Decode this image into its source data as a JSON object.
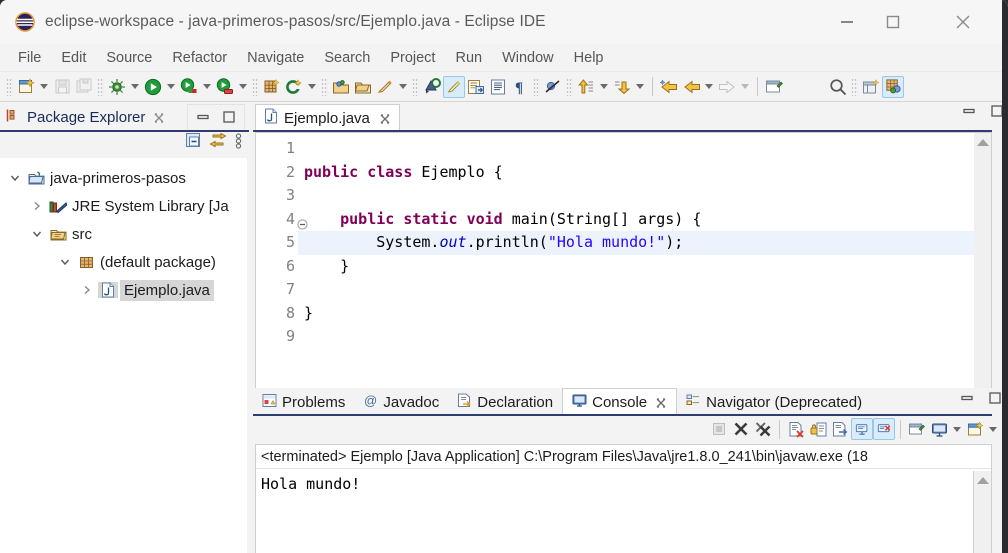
{
  "window": {
    "title": "eclipse-workspace - java-primeros-pasos/src/Ejemplo.java - Eclipse IDE",
    "logo_icon": "eclipse-logo",
    "minimize_label": "—",
    "maximize_label": "☐",
    "close_label": "✕",
    "chrome_color": "#f6f6f6",
    "accent_color": "#2e3c6e"
  },
  "menubar": {
    "items": [
      {
        "label": "File"
      },
      {
        "label": "Edit"
      },
      {
        "label": "Source"
      },
      {
        "label": "Refactor"
      },
      {
        "label": "Navigate"
      },
      {
        "label": "Search"
      },
      {
        "label": "Project"
      },
      {
        "label": "Run"
      },
      {
        "label": "Window"
      },
      {
        "label": "Help"
      }
    ]
  },
  "toolbar": {
    "groups": [
      {
        "items": [
          {
            "icon": "new-wizard-icon",
            "enabled": true,
            "dropdown": true
          },
          {
            "icon": "save-icon",
            "enabled": false
          },
          {
            "icon": "save-all-icon",
            "enabled": false
          }
        ]
      },
      {
        "items": [
          {
            "icon": "debug-icon",
            "enabled": true,
            "dropdown": true
          },
          {
            "icon": "run-icon",
            "enabled": true,
            "dropdown": true
          },
          {
            "icon": "run-external-tools-icon",
            "enabled": true,
            "dropdown": true
          },
          {
            "icon": "coverage-icon",
            "enabled": true,
            "dropdown": true
          }
        ]
      },
      {
        "items": [
          {
            "icon": "new-java-package-icon",
            "enabled": true
          },
          {
            "icon": "new-java-class-icon",
            "enabled": true,
            "dropdown": true
          }
        ]
      },
      {
        "items": [
          {
            "icon": "open-type-icon",
            "enabled": true
          },
          {
            "icon": "open-task-icon",
            "enabled": true
          },
          {
            "icon": "toggle-mark-occurrences-icon",
            "enabled": true,
            "dropdown": true
          }
        ]
      },
      {
        "items": [
          {
            "icon": "search-type-icon",
            "enabled": true
          },
          {
            "icon": "toggle-highlight-icon",
            "enabled": true,
            "selected": true
          },
          {
            "icon": "block-selection-icon",
            "enabled": true
          },
          {
            "icon": "show-whitespace-icon",
            "enabled": true
          },
          {
            "icon": "pilcrow-icon",
            "enabled": true
          }
        ]
      },
      {
        "items": [
          {
            "icon": "skip-all-breakpoints-icon",
            "enabled": true
          }
        ]
      },
      {
        "items": [
          {
            "icon": "next-annotation-icon",
            "enabled": true,
            "dropdown": true
          },
          {
            "icon": "previous-annotation-icon",
            "enabled": true,
            "dropdown": true
          }
        ]
      },
      {
        "items": [
          {
            "icon": "back-history-icon",
            "enabled": true
          },
          {
            "icon": "forward-history-icon",
            "enabled": true,
            "dropdown": true
          },
          {
            "icon": "forward-arrow-icon",
            "enabled": false,
            "dropdown": true
          }
        ]
      },
      {
        "items": [
          {
            "icon": "new-window-icon",
            "enabled": true
          }
        ]
      },
      {
        "items": [
          {
            "icon": "quick-access-search-icon",
            "enabled": true
          }
        ]
      },
      {
        "items": [
          {
            "icon": "open-perspective-icon",
            "enabled": true
          },
          {
            "icon": "java-perspective-icon",
            "enabled": true,
            "selected": true
          }
        ]
      }
    ]
  },
  "package_explorer": {
    "tab_label": "Package Explorer",
    "tab_icon": "package-explorer-icon",
    "close_icon": "close-icon",
    "view_buttons": [
      {
        "icon": "minimize-icon"
      },
      {
        "icon": "maximize-icon"
      }
    ],
    "toolbar": [
      {
        "icon": "collapse-all-icon"
      },
      {
        "icon": "link-with-editor-icon"
      },
      {
        "icon": "view-menu-icon"
      }
    ],
    "tree": [
      {
        "label": "java-primeros-pasos",
        "icon": "java-project-icon",
        "indent": 0,
        "twisty": "expanded",
        "selected": false
      },
      {
        "label": "JRE System Library [Ja",
        "icon": "jre-library-icon",
        "indent": 1,
        "twisty": "collapsed",
        "selected": false
      },
      {
        "label": "src",
        "icon": "source-folder-icon",
        "indent": 1,
        "twisty": "expanded",
        "selected": false
      },
      {
        "label": "(default package)",
        "icon": "package-icon",
        "indent": 2,
        "twisty": "expanded",
        "selected": false
      },
      {
        "label": "Ejemplo.java",
        "icon": "java-file-icon",
        "indent": 3,
        "twisty": "collapsed",
        "selected": true
      }
    ]
  },
  "editor": {
    "tab_label": "Ejemplo.java",
    "tab_icon": "java-file-icon",
    "close_icon": "close-icon",
    "view_buttons": [
      {
        "icon": "minimize-icon"
      },
      {
        "icon": "maximize-icon"
      }
    ],
    "lines": [
      {
        "number": "1",
        "tokens": []
      },
      {
        "number": "2",
        "tokens": [
          {
            "t": "public",
            "c": "kw"
          },
          {
            "t": " ",
            "c": "pl"
          },
          {
            "t": "class",
            "c": "kw"
          },
          {
            "t": " Ejemplo {",
            "c": "pl"
          }
        ]
      },
      {
        "number": "3",
        "tokens": []
      },
      {
        "number": "4",
        "fold": true,
        "tokens": [
          {
            "t": "    ",
            "c": "pl"
          },
          {
            "t": "public",
            "c": "kw"
          },
          {
            "t": " ",
            "c": "pl"
          },
          {
            "t": "static",
            "c": "kw"
          },
          {
            "t": " ",
            "c": "pl"
          },
          {
            "t": "void",
            "c": "kw"
          },
          {
            "t": " main(String[] args) {",
            "c": "pl"
          }
        ]
      },
      {
        "number": "5",
        "highlight": true,
        "tokens": [
          {
            "t": "        System.",
            "c": "pl"
          },
          {
            "t": "out",
            "c": "fld"
          },
          {
            "t": ".println(",
            "c": "pl"
          },
          {
            "t": "\"Hola mundo!\"",
            "c": "str"
          },
          {
            "t": ");",
            "c": "pl"
          }
        ]
      },
      {
        "number": "6",
        "tokens": [
          {
            "t": "    }",
            "c": "pl"
          }
        ]
      },
      {
        "number": "7",
        "tokens": []
      },
      {
        "number": "8",
        "tokens": [
          {
            "t": "}",
            "c": "pl"
          }
        ]
      },
      {
        "number": "9",
        "tokens": []
      }
    ],
    "scrollbar": {
      "up_icon": "scroll-up-arrow-icon",
      "down_icon": "scroll-down-arrow-icon",
      "left_icon": "scroll-left-arrow-icon",
      "right_icon": "scroll-right-arrow-icon"
    }
  },
  "bottom_panel": {
    "tabs": [
      {
        "label": "Problems",
        "icon": "problems-icon",
        "active": false,
        "closable": false
      },
      {
        "label": "Javadoc",
        "icon": "javadoc-at-icon",
        "active": false,
        "closable": false
      },
      {
        "label": "Declaration",
        "icon": "declaration-icon",
        "active": false,
        "closable": false
      },
      {
        "label": "Console",
        "icon": "console-icon",
        "active": true,
        "closable": true
      },
      {
        "label": "Navigator (Deprecated)",
        "icon": "navigator-icon",
        "active": false,
        "closable": false
      }
    ],
    "close_icon": "close-icon",
    "view_buttons": [
      {
        "icon": "minimize-icon"
      },
      {
        "icon": "maximize-icon"
      }
    ],
    "toolbar": [
      {
        "icon": "terminate-icon",
        "enabled": false
      },
      {
        "icon": "remove-launch-icon",
        "enabled": true
      },
      {
        "icon": "remove-all-terminated-icon",
        "enabled": true
      },
      {
        "icon": "clear-console-icon",
        "enabled": true
      },
      {
        "icon": "scroll-lock-icon",
        "enabled": true
      },
      {
        "icon": "word-wrap-icon",
        "enabled": true
      },
      {
        "icon": "show-console-on-output-icon",
        "enabled": true,
        "selected": true
      },
      {
        "icon": "show-console-on-error-icon",
        "enabled": true,
        "selected": true
      },
      {
        "icon": "pin-console-icon",
        "enabled": true
      },
      {
        "icon": "display-selected-console-icon",
        "enabled": true,
        "dropdown": true
      },
      {
        "icon": "open-console-icon",
        "enabled": true,
        "dropdown": true
      }
    ],
    "console": {
      "status_line": "<terminated> Ejemplo [Java Application] C:\\Program Files\\Java\\jre1.8.0_241\\bin\\javaw.exe  (18",
      "output": "Hola mundo!"
    }
  }
}
